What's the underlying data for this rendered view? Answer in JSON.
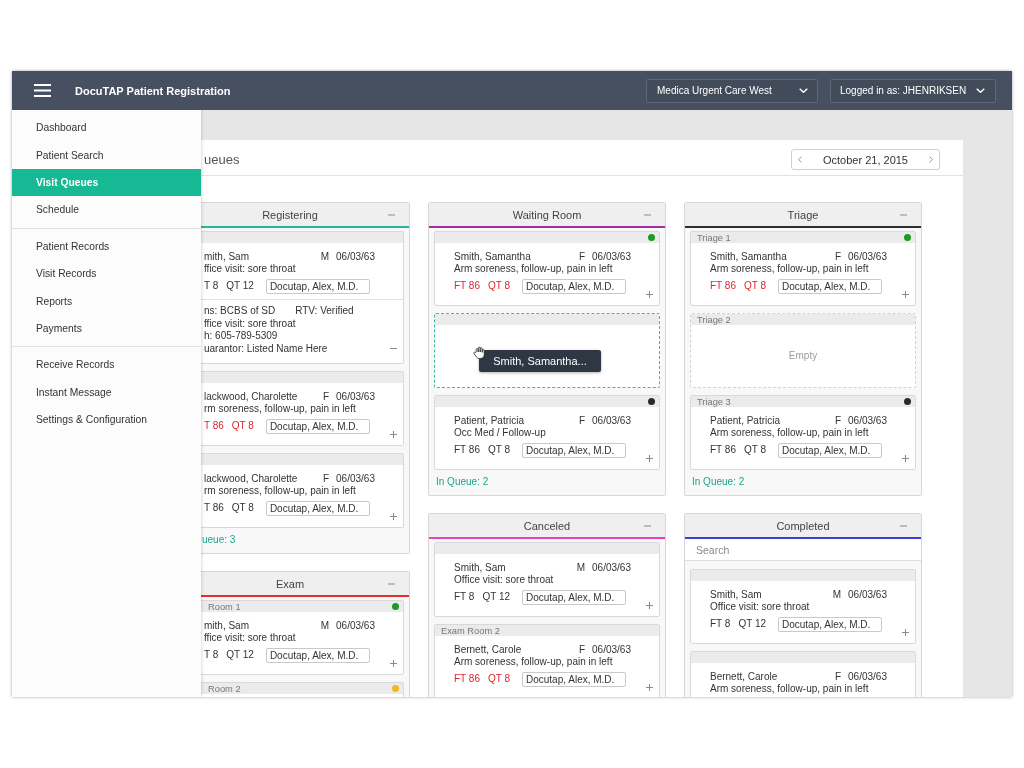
{
  "app": {
    "title": "DocuTAP Patient Registration"
  },
  "location": {
    "value": "Medica Urgent Care West"
  },
  "user_menu": {
    "label": "Logged in as: JHENRIKSEN"
  },
  "sidebar": {
    "groups": [
      {
        "items": [
          {
            "label": "Dashboard",
            "selected": false
          },
          {
            "label": "Patient Search",
            "selected": false
          },
          {
            "label": "Visit Queues",
            "selected": true
          },
          {
            "label": "Schedule",
            "selected": false
          }
        ]
      },
      {
        "items": [
          {
            "label": "Patient Records",
            "selected": false
          },
          {
            "label": "Visit Records",
            "selected": false
          },
          {
            "label": "Reports",
            "selected": false
          },
          {
            "label": "Payments",
            "selected": false
          }
        ]
      },
      {
        "items": [
          {
            "label": "Receive Records",
            "selected": false
          },
          {
            "label": "Instant Message",
            "selected": false
          },
          {
            "label": "Settings & Configuration",
            "selected": false
          }
        ]
      }
    ]
  },
  "page": {
    "title": "ueues",
    "date_picker": {
      "date": "October 21, 2015"
    }
  },
  "board": {
    "columns": [
      {
        "queues": [
          {
            "title": "Registering",
            "color": "#2bb3a0",
            "cards": [
              {
                "kind": "patient",
                "name": "mith, Sam",
                "sex": "M",
                "dob": "06/03/63",
                "reason": "ffice visit: sore throat",
                "ft": "T 8",
                "qt": "QT 12",
                "alert": false,
                "provider": "Docutap, Alex, M.D.",
                "expanded": true,
                "details": [
                  {
                    "text": "ns: BCBS of SD",
                    "aside": "RTV: Verified"
                  },
                  {
                    "text": "ffice visit: sore throat"
                  },
                  {
                    "text": "h: 605-789-5309"
                  },
                  {
                    "text": "uarantor: Listed Name Here"
                  }
                ]
              },
              {
                "kind": "patient",
                "name": "lackwood, Charolette",
                "sex": "F",
                "dob": "06/03/63",
                "reason": "rm soreness, follow-up, pain in left",
                "ft": "T 86",
                "qt": "QT 8",
                "alert": true,
                "provider": "Docutap, Alex, M.D.",
                "expanded": false
              },
              {
                "kind": "patient",
                "name": "lackwood, Charolette",
                "sex": "F",
                "dob": "06/03/63",
                "reason": "rm soreness, follow-up, pain in left",
                "ft": "T 86",
                "qt": "QT 8",
                "alert": false,
                "provider": "Docutap, Alex, M.D.",
                "expanded": false
              }
            ],
            "count": "ueue: 3"
          },
          {
            "title": "Exam",
            "color": "#e4312f",
            "cards": [
              {
                "kind": "patient",
                "slot": "Room 1",
                "color": "#1e9a26",
                "name": "mith, Sam",
                "sex": "M",
                "dob": "06/03/63",
                "reason": "ffice visit: sore throat",
                "ft": "T 8",
                "qt": "QT 12",
                "alert": false,
                "provider": "Docutap, Alex, M.D.",
                "expanded": false
              },
              {
                "kind": "patient",
                "slot": "Room 2",
                "color": "#f4b81c"
              }
            ]
          }
        ]
      },
      {
        "queues": [
          {
            "title": "Waiting Room",
            "color": "#a1309e",
            "cards": [
              {
                "kind": "patient",
                "color": "#1e9a26",
                "name": "Smith, Samantha",
                "sex": "F",
                "dob": "06/03/63",
                "reason": "Arm soreness, follow-up, pain in left",
                "ft": "FT 86",
                "qt": "QT 8",
                "alert": true,
                "provider": "Docutap, Alex, M.D.",
                "expanded": false
              },
              {
                "kind": "drop-target",
                "drag_label": "Smith, Samantha..."
              },
              {
                "kind": "patient",
                "color": "#2a2a2a",
                "name": "Patient, Patricia",
                "sex": "F",
                "dob": "06/03/63",
                "reason": "Occ Med / Follow-up",
                "ft": "FT 86",
                "qt": "QT 8",
                "alert": false,
                "provider": "Docutap, Alex, M.D.",
                "expanded": false
              }
            ],
            "count": "In Queue: 2"
          },
          {
            "title": "Canceled",
            "color": "#ec3fbe",
            "cards": [
              {
                "kind": "patient",
                "name": "Smith, Sam",
                "sex": "M",
                "dob": "06/03/63",
                "reason": "Office visit: sore throat",
                "ft": "FT 8",
                "qt": "QT 12",
                "alert": false,
                "provider": "Docutap, Alex, M.D.",
                "expanded": false
              },
              {
                "kind": "patient",
                "slot": "Exam Room 2",
                "name": "Bernett, Carole",
                "sex": "F",
                "dob": "06/03/63",
                "reason": "Arm soreness, follow-up, pain in left",
                "ft": "FT 86",
                "qt": "QT 8",
                "alert": true,
                "provider": "Docutap, Alex, M.D.",
                "expanded": false
              }
            ]
          }
        ]
      },
      {
        "queues": [
          {
            "title": "Triage",
            "color": "#2e2e2e",
            "cards": [
              {
                "kind": "patient",
                "slot": "Triage 1",
                "color": "#1e9a26",
                "name": "Smith, Samantha",
                "sex": "F",
                "dob": "06/03/63",
                "reason": "Arm soreness, follow-up, pain in left",
                "ft": "FT 86",
                "qt": "QT 8",
                "alert": true,
                "provider": "Docutap, Alex, M.D.",
                "expanded": false
              },
              {
                "kind": "empty",
                "slot": "Triage 2",
                "label": "Empty"
              },
              {
                "kind": "patient",
                "slot": "Triage 3",
                "color": "#2a2a2a",
                "name": "Patient, Patricia",
                "sex": "F",
                "dob": "06/03/63",
                "reason": "Arm soreness, follow-up, pain in left",
                "ft": "FT 86",
                "qt": "QT 8",
                "alert": false,
                "provider": "Docutap, Alex, M.D.",
                "expanded": false
              }
            ],
            "count": "In Queue: 2"
          },
          {
            "title": "Completed",
            "color": "#3b3fd6",
            "search": {
              "placeholder": "Search"
            },
            "cards": [
              {
                "kind": "patient",
                "name": "Smith, Sam",
                "sex": "M",
                "dob": "06/03/63",
                "reason": "Office visit: sore throat",
                "ft": "FT 8",
                "qt": "QT 12",
                "alert": false,
                "provider": "Docutap, Alex, M.D.",
                "expanded": false
              },
              {
                "kind": "patient",
                "name": "Bernett, Carole",
                "sex": "F",
                "dob": "06/03/63",
                "reason": "Arm soreness, follow-up, pain in left"
              }
            ]
          }
        ]
      }
    ]
  }
}
